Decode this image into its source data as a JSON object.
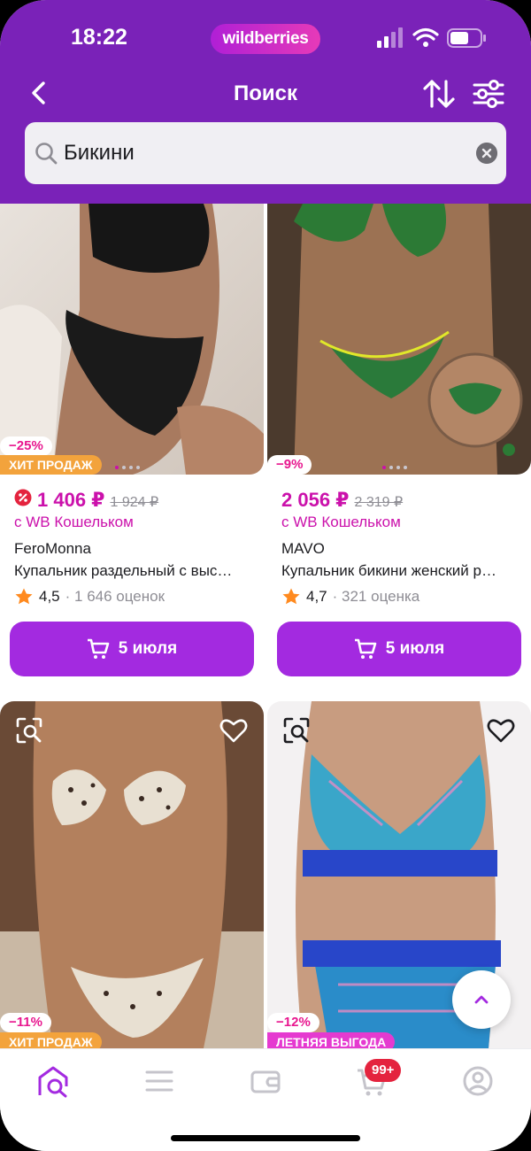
{
  "status_bar": {
    "time": "18:22",
    "brand": "wildberries"
  },
  "nav": {
    "title": "Поиск"
  },
  "search": {
    "query": "Бикини"
  },
  "products": [
    {
      "discount": "−25%",
      "label": "ХИТ ПРОДАЖ",
      "price": "1 406 ₽",
      "old_price": "1 924 ₽",
      "wallet": "с WB Кошельком",
      "brand": "FeroMonna",
      "title": "Купальник раздельный с выс…",
      "rating": "4,5",
      "reviews": "· 1 646 оценок",
      "delivery": "5 июля",
      "image_colors": [
        "#d9cfc5",
        "#a57b63"
      ]
    },
    {
      "discount": "−9%",
      "price": "2 056 ₽",
      "old_price": "2 319 ₽",
      "wallet": "с WB Кошельком",
      "brand": "MAVO",
      "title": "Купальник бикини женский р…",
      "rating": "4,7",
      "reviews": "· 321 оценка",
      "delivery": "5 июля",
      "image_colors": [
        "#5a4634",
        "#a07657"
      ]
    },
    {
      "discount": "−11%",
      "label": "ХИТ ПРОДАЖ",
      "image_colors": [
        "#6a4a36",
        "#b3805d"
      ]
    },
    {
      "discount": "−12%",
      "label": "ЛЕТНЯЯ ВЫГОДА",
      "image_colors": [
        "#f3f1f2",
        "#c89c80"
      ]
    }
  ],
  "tabbar": {
    "cart_count": "99+"
  },
  "colors": {
    "header": "#7a22b8",
    "accent": "#cb11ab",
    "button": "#a32ae0",
    "hit": "#f3a33c"
  },
  "icons": [
    "back-icon",
    "sort-icon",
    "filter-icon",
    "search-icon",
    "clear-icon",
    "cart-icon",
    "star-icon",
    "heart-icon",
    "image-search-icon",
    "chevron-up-icon",
    "home-search-icon",
    "menu-icon",
    "wallet-icon",
    "profile-icon"
  ]
}
